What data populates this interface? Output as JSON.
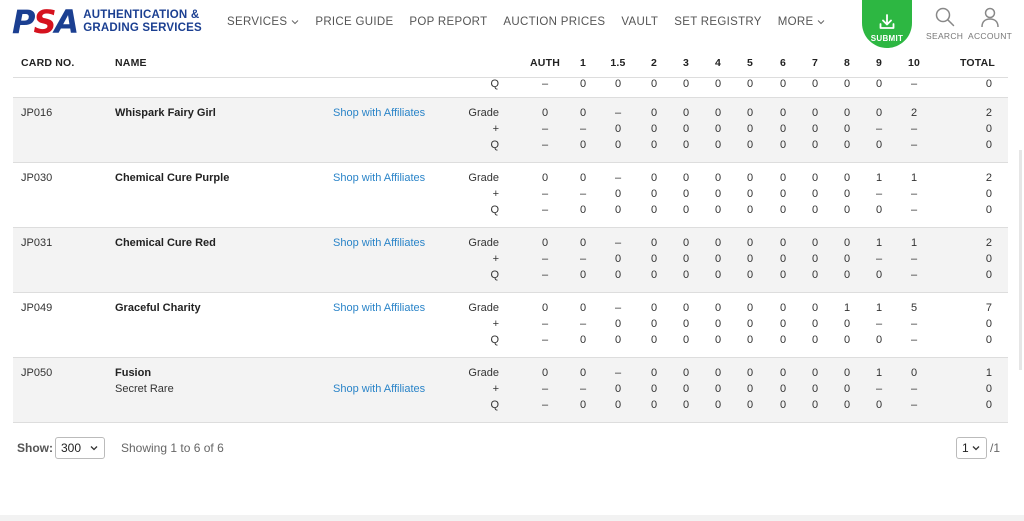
{
  "header": {
    "logo_letters": [
      "P",
      "S",
      "A"
    ],
    "logo_line1": "AUTHENTICATION &",
    "logo_line2": "GRADING SERVICES",
    "nav": [
      {
        "label": "SERVICES",
        "has_chevron": true
      },
      {
        "label": "PRICE GUIDE",
        "has_chevron": false
      },
      {
        "label": "POP REPORT",
        "has_chevron": false
      },
      {
        "label": "AUCTION PRICES",
        "has_chevron": false
      },
      {
        "label": "VAULT",
        "has_chevron": false
      },
      {
        "label": "SET REGISTRY",
        "has_chevron": false
      },
      {
        "label": "MORE",
        "has_chevron": true
      }
    ],
    "submit_label": "SUBMIT",
    "search_label": "SEARCH",
    "account_label": "ACCOUNT",
    "submit_color": "#2db742",
    "brand_blue": "#1b3f91",
    "brand_red": "#d5121e"
  },
  "table": {
    "columns": [
      "CARD NO.",
      "NAME",
      "AUTH",
      "1",
      "1.5",
      "2",
      "3",
      "4",
      "5",
      "6",
      "7",
      "8",
      "9",
      "10",
      "TOTAL"
    ],
    "partial_row": {
      "label": "Q",
      "values": [
        "–",
        "0",
        "0",
        "0",
        "0",
        "0",
        "0",
        "0",
        "0",
        "0",
        "0",
        "–",
        "0"
      ]
    },
    "rows": [
      {
        "card_no": "JP016",
        "name": "Whispark Fairy Girl",
        "subname": "",
        "link": "Shop with Affiliates",
        "grade": [
          "0",
          "0",
          "–",
          "0",
          "0",
          "0",
          "0",
          "0",
          "0",
          "0",
          "0",
          "2",
          "2"
        ],
        "plus": [
          "–",
          "–",
          "0",
          "0",
          "0",
          "0",
          "0",
          "0",
          "0",
          "0",
          "–",
          "–",
          "0"
        ],
        "q": [
          "–",
          "0",
          "0",
          "0",
          "0",
          "0",
          "0",
          "0",
          "0",
          "0",
          "0",
          "–",
          "0"
        ]
      },
      {
        "card_no": "JP030",
        "name": "Chemical Cure Purple",
        "subname": "",
        "link": "Shop with Affiliates",
        "grade": [
          "0",
          "0",
          "–",
          "0",
          "0",
          "0",
          "0",
          "0",
          "0",
          "0",
          "1",
          "1",
          "2"
        ],
        "plus": [
          "–",
          "–",
          "0",
          "0",
          "0",
          "0",
          "0",
          "0",
          "0",
          "0",
          "–",
          "–",
          "0"
        ],
        "q": [
          "–",
          "0",
          "0",
          "0",
          "0",
          "0",
          "0",
          "0",
          "0",
          "0",
          "0",
          "–",
          "0"
        ]
      },
      {
        "card_no": "JP031",
        "name": "Chemical Cure Red",
        "subname": "",
        "link": "Shop with Affiliates",
        "grade": [
          "0",
          "0",
          "–",
          "0",
          "0",
          "0",
          "0",
          "0",
          "0",
          "0",
          "1",
          "1",
          "2"
        ],
        "plus": [
          "–",
          "–",
          "0",
          "0",
          "0",
          "0",
          "0",
          "0",
          "0",
          "0",
          "–",
          "–",
          "0"
        ],
        "q": [
          "–",
          "0",
          "0",
          "0",
          "0",
          "0",
          "0",
          "0",
          "0",
          "0",
          "0",
          "–",
          "0"
        ]
      },
      {
        "card_no": "JP049",
        "name": "Graceful Charity",
        "subname": "",
        "link": "Shop with Affiliates",
        "grade": [
          "0",
          "0",
          "–",
          "0",
          "0",
          "0",
          "0",
          "0",
          "0",
          "1",
          "1",
          "5",
          "7"
        ],
        "plus": [
          "–",
          "–",
          "0",
          "0",
          "0",
          "0",
          "0",
          "0",
          "0",
          "0",
          "–",
          "–",
          "0"
        ],
        "q": [
          "–",
          "0",
          "0",
          "0",
          "0",
          "0",
          "0",
          "0",
          "0",
          "0",
          "0",
          "–",
          "0"
        ]
      },
      {
        "card_no": "JP050",
        "name": "Fusion",
        "subname": "Secret Rare",
        "link": "Shop with Affiliates",
        "grade": [
          "0",
          "0",
          "–",
          "0",
          "0",
          "0",
          "0",
          "0",
          "0",
          "0",
          "1",
          "0",
          "1"
        ],
        "plus": [
          "–",
          "–",
          "0",
          "0",
          "0",
          "0",
          "0",
          "0",
          "0",
          "0",
          "–",
          "–",
          "0"
        ],
        "q": [
          "–",
          "0",
          "0",
          "0",
          "0",
          "0",
          "0",
          "0",
          "0",
          "0",
          "0",
          "–",
          "0"
        ]
      }
    ],
    "grade_labels": {
      "grade": "Grade",
      "plus": "+",
      "q": "Q"
    },
    "link_color": "#2a84c8"
  },
  "footer": {
    "show_label": "Show:",
    "show_value": "300",
    "showing_text": "Showing 1 to 6 of 6",
    "page_value": "1",
    "page_of": "/1"
  }
}
